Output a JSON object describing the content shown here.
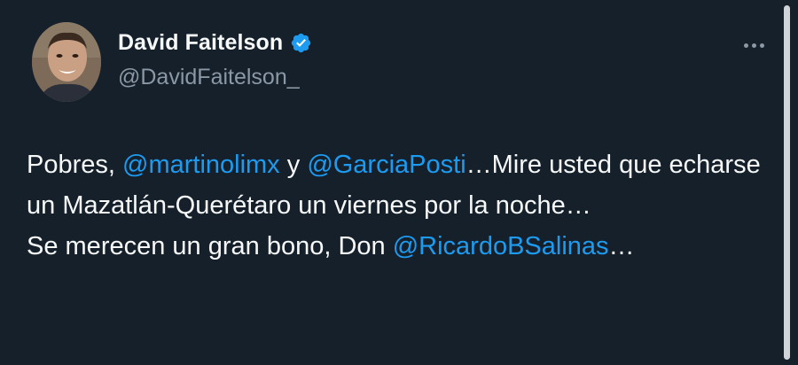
{
  "author": {
    "display_name": "David Faitelson",
    "handle": "@DavidFaitelson_",
    "verified": true
  },
  "tweet": {
    "line1_a": "Pobres, ",
    "mention1": "@martinolimx",
    "line1_b": " y ",
    "mention2": "@GarciaPosti",
    "line1_c": "…Mire usted que echarse un Mazatlán-Querétaro un viernes por la noche…",
    "line2_a": "Se merecen un gran bono, Don ",
    "mention3": "@RicardoBSalinas",
    "line2_b": "…"
  },
  "icons": {
    "verified": "verified-badge-icon",
    "more": "more-options-icon"
  },
  "colors": {
    "background": "#15202b",
    "text": "#f7f9f9",
    "secondary": "#8b98a5",
    "accent": "#1d9bf0"
  }
}
